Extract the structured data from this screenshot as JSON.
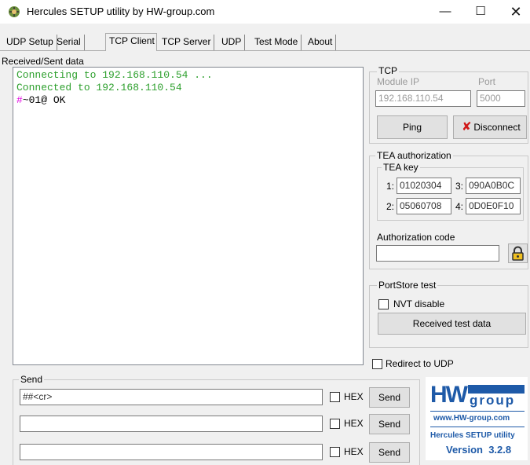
{
  "window": {
    "title": "Hercules SETUP utility by HW-group.com"
  },
  "tabs": [
    {
      "label": "UDP Setup"
    },
    {
      "label": "Serial"
    },
    {
      "label": "TCP Client"
    },
    {
      "label": "TCP Server"
    },
    {
      "label": "UDP"
    },
    {
      "label": "Test Mode"
    },
    {
      "label": "About"
    }
  ],
  "received_label": "Received/Sent data",
  "log": [
    {
      "prefix": "",
      "text": "Connecting to 192.168.110.54 ..."
    },
    {
      "prefix": "",
      "text": "Connected to 192.168.110.54"
    },
    {
      "prefix": "#",
      "text": "~01@ OK"
    }
  ],
  "tcp": {
    "title": "TCP",
    "module_ip_label": "Module IP",
    "port_label": "Port",
    "module_ip": "192.168.110.54",
    "port": "5000",
    "ping_label": "Ping",
    "disconnect_label": "Disconnect"
  },
  "tea": {
    "title": "TEA authorization",
    "key_title": "TEA key",
    "keys": [
      {
        "n": "1:",
        "value": "01020304"
      },
      {
        "n": "3:",
        "value": "090A0B0C"
      },
      {
        "n": "2:",
        "value": "05060708"
      },
      {
        "n": "4:",
        "value": "0D0E0F10"
      }
    ],
    "auth_label": "Authorization code",
    "auth_value": ""
  },
  "portstore": {
    "title": "PortStore test",
    "nvt_label": "NVT disable",
    "received_btn": "Received test data"
  },
  "redirect_label": "Redirect to UDP",
  "send": {
    "title": "Send",
    "rows": [
      {
        "value": "##<cr>",
        "hex_label": "HEX",
        "send_label": "Send"
      },
      {
        "value": "",
        "hex_label": "HEX",
        "send_label": "Send"
      },
      {
        "value": "",
        "hex_label": "HEX",
        "send_label": "Send"
      }
    ]
  },
  "logo": {
    "hw": "HW",
    "group": "group",
    "url": "www.HW-group.com",
    "product": "Hercules SETUP utility",
    "version": "Version  3.2.8"
  }
}
